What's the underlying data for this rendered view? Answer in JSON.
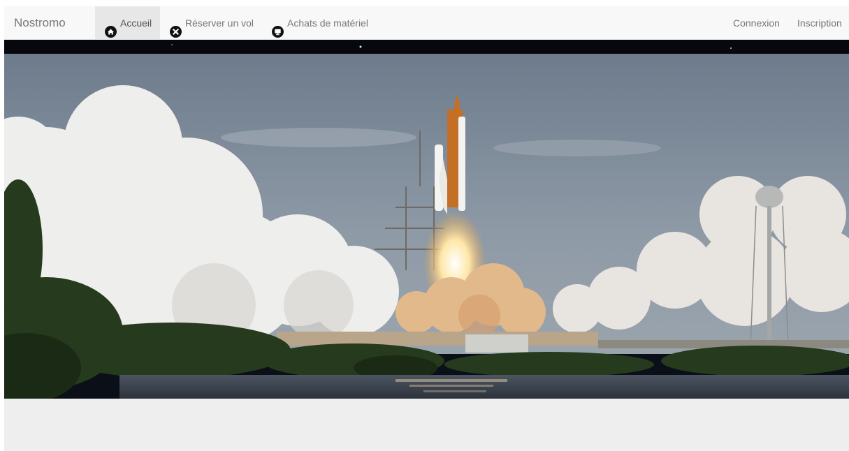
{
  "navbar": {
    "brand": "Nostromo",
    "items": [
      {
        "label": "Accueil",
        "icon": "home-icon",
        "active": true
      },
      {
        "label": "Réserver un vol",
        "icon": "flight-icon",
        "active": false
      },
      {
        "label": "Achats de matériel",
        "icon": "monitor-icon",
        "active": false
      }
    ],
    "right": [
      {
        "label": "Connexion"
      },
      {
        "label": "Inscription"
      }
    ]
  },
  "hero": {
    "image": "shuttle-launch-photo"
  },
  "colors": {
    "navbar_bg": "#f8f8f8",
    "nav_text": "#777777",
    "active_bg": "#e7e7e7",
    "page_bg": "#eeeeee"
  }
}
